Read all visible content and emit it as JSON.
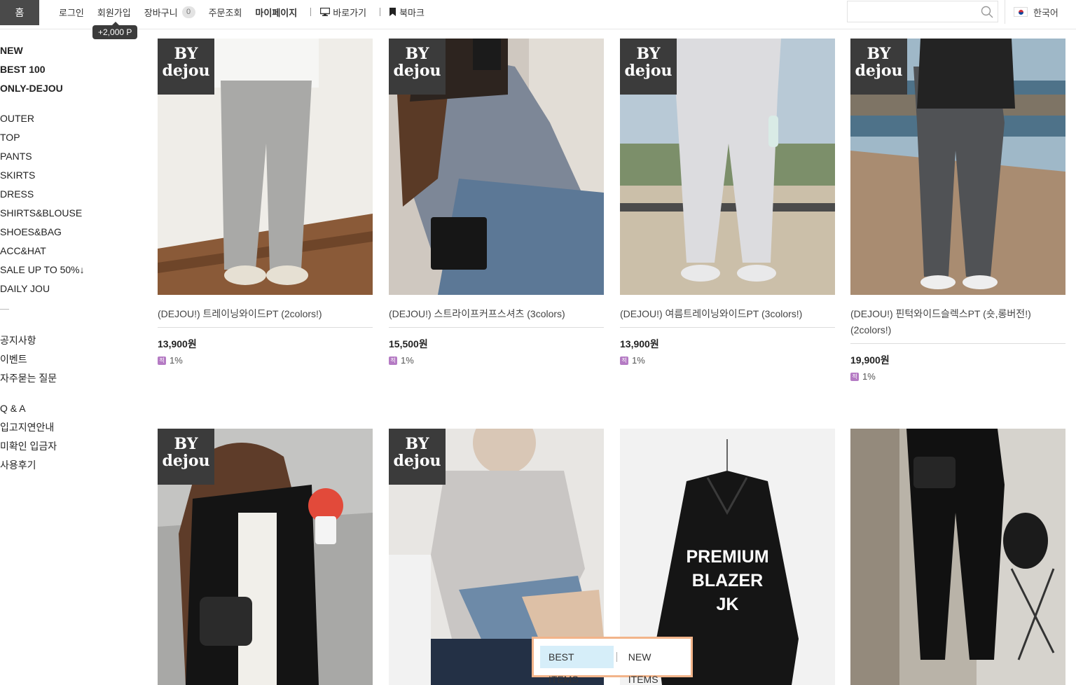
{
  "topbar": {
    "home_label": "홈",
    "login": "로그인",
    "signup": "회원가입",
    "cart": "장바구니",
    "cart_count": "0",
    "order_lookup": "주문조회",
    "mypage": "마이페이지",
    "shortcut": "바로가기",
    "bookmark": "북마크",
    "points_tooltip": "+2,000 P",
    "search_placeholder": "",
    "language": "한국어"
  },
  "sidebar": {
    "featured": [
      "NEW",
      "BEST 100",
      "ONLY-DEJOU"
    ],
    "categories": [
      "OUTER",
      "TOP",
      "PANTS",
      "SKIRTS",
      "DRESS",
      "SHIRTS&BLOUSE",
      "SHOES&BAG",
      "ACC&HAT",
      "SALE UP TO 50%↓",
      "DAILY JOU"
    ],
    "community": [
      "공지사항",
      "이벤트",
      "자주묻는 질문"
    ],
    "board": [
      "Q & A",
      "입고지연안내",
      "미확인 입금자",
      "사용후기"
    ]
  },
  "badge": {
    "line1": "BY",
    "line2": "dejou"
  },
  "products": [
    {
      "name": "(DEJOU!) 트레이닝와이드PT (2colors!)",
      "price": "13,900원",
      "reward": "1%",
      "badge": true
    },
    {
      "name": "(DEJOU!) 스트라이프커프스셔츠 (3colors)",
      "price": "15,500원",
      "reward": "1%",
      "badge": true
    },
    {
      "name": "(DEJOU!) 여름트레이닝와이드PT (3colors!)",
      "price": "13,900원",
      "reward": "1%",
      "badge": true
    },
    {
      "name": "(DEJOU!) 핀턱와이드슬렉스PT (숏,롱버전!) (2colors!)",
      "price": "19,900원",
      "reward": "1%",
      "badge": true
    },
    {
      "badge": true
    },
    {
      "badge": true
    },
    {
      "overlay_text": [
        "PREMIUM",
        "BLAZER",
        "JK"
      ],
      "badge": false
    },
    {
      "badge": false
    }
  ],
  "float_tabs": {
    "best": "BEST ITEMS",
    "new": "NEW ITEMS"
  },
  "colors": {
    "accent_border": "#f2b48a",
    "active_tab": "#d6eef9",
    "badge_bg": "#3b3b3b",
    "topbar_home": "#4a4a4a"
  }
}
